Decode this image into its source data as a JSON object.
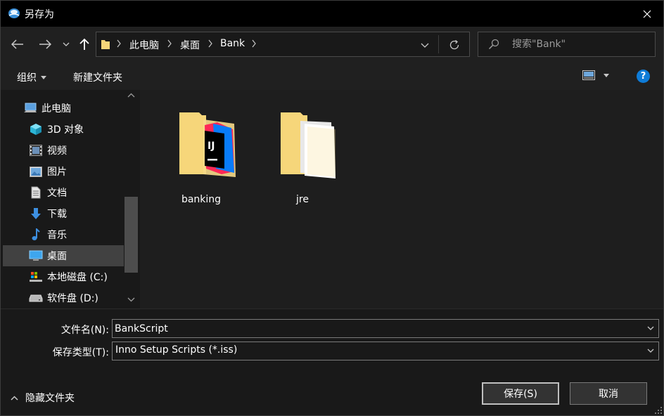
{
  "window": {
    "title": "另存为"
  },
  "nav": {
    "breadcrumbs": [
      "此电脑",
      "桌面",
      "Bank"
    ],
    "search_placeholder": "搜索\"Bank\""
  },
  "toolbar": {
    "organize_label": "组织",
    "new_folder_label": "新建文件夹",
    "help_label": "?"
  },
  "sidebar": {
    "items": [
      {
        "label": "此电脑",
        "icon": "computer-icon"
      },
      {
        "label": "3D 对象",
        "icon": "cube-3d-icon"
      },
      {
        "label": "视频",
        "icon": "video-icon"
      },
      {
        "label": "图片",
        "icon": "pictures-icon"
      },
      {
        "label": "文档",
        "icon": "documents-icon"
      },
      {
        "label": "下载",
        "icon": "download-icon"
      },
      {
        "label": "音乐",
        "icon": "music-icon"
      },
      {
        "label": "桌面",
        "icon": "desktop-icon",
        "selected": true
      },
      {
        "label": "本地磁盘 (C:)",
        "icon": "drive-c-icon"
      },
      {
        "label": "软件盘 (D:)",
        "icon": "drive-d-icon"
      }
    ]
  },
  "files": [
    {
      "name": "banking",
      "icon": "intellij-folder-icon"
    },
    {
      "name": "jre",
      "icon": "folder-icon"
    }
  ],
  "form": {
    "filename_label": "文件名(N):",
    "filename_value": "BankScript",
    "filetype_label": "保存类型(T):",
    "filetype_value": "Inno Setup Scripts (*.iss)"
  },
  "footer": {
    "hide_folders_label": "隐藏文件夹",
    "save_label": "保存(S)",
    "cancel_label": "取消"
  },
  "colors": {
    "accent": "#0e7cd8",
    "folder": "#f6d67a",
    "selection": "#414141"
  }
}
